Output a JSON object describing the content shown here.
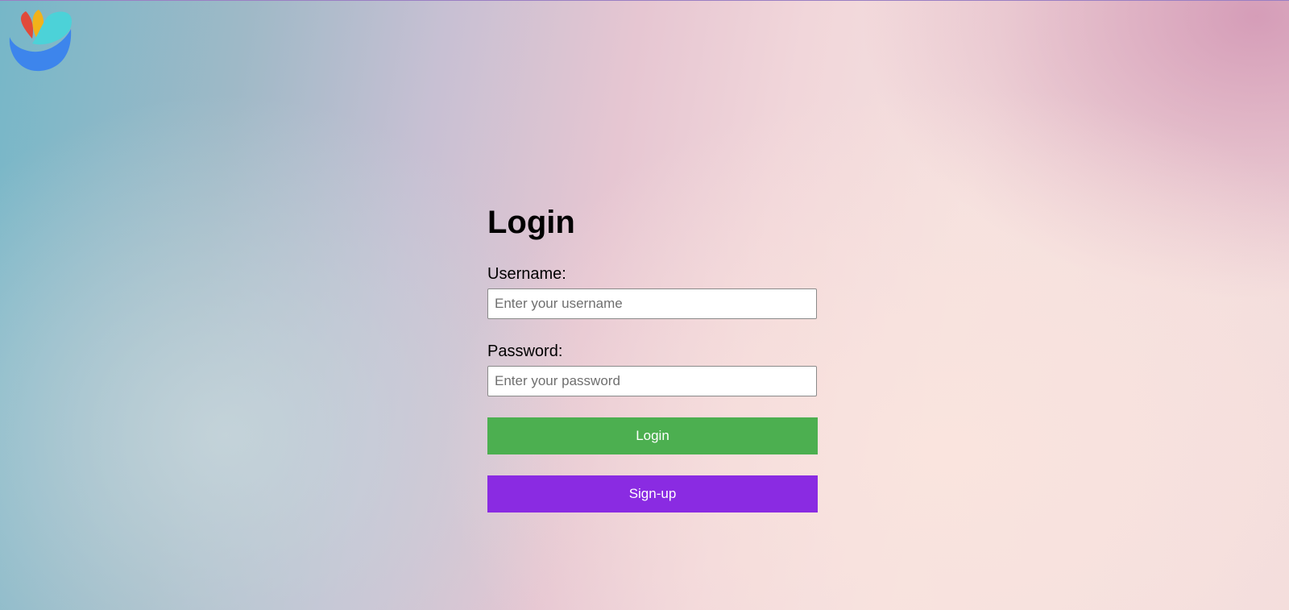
{
  "logo": {
    "icon": "colorful-bird-logo-icon"
  },
  "login_form": {
    "title": "Login",
    "username_label": "Username:",
    "username_placeholder": "Enter your username",
    "username_value": "",
    "password_label": "Password:",
    "password_placeholder": "Enter your password",
    "password_value": "",
    "login_button": "Login",
    "signup_button": "Sign-up"
  },
  "colors": {
    "login_button": "#4caf50",
    "signup_button": "#8a2be2"
  }
}
